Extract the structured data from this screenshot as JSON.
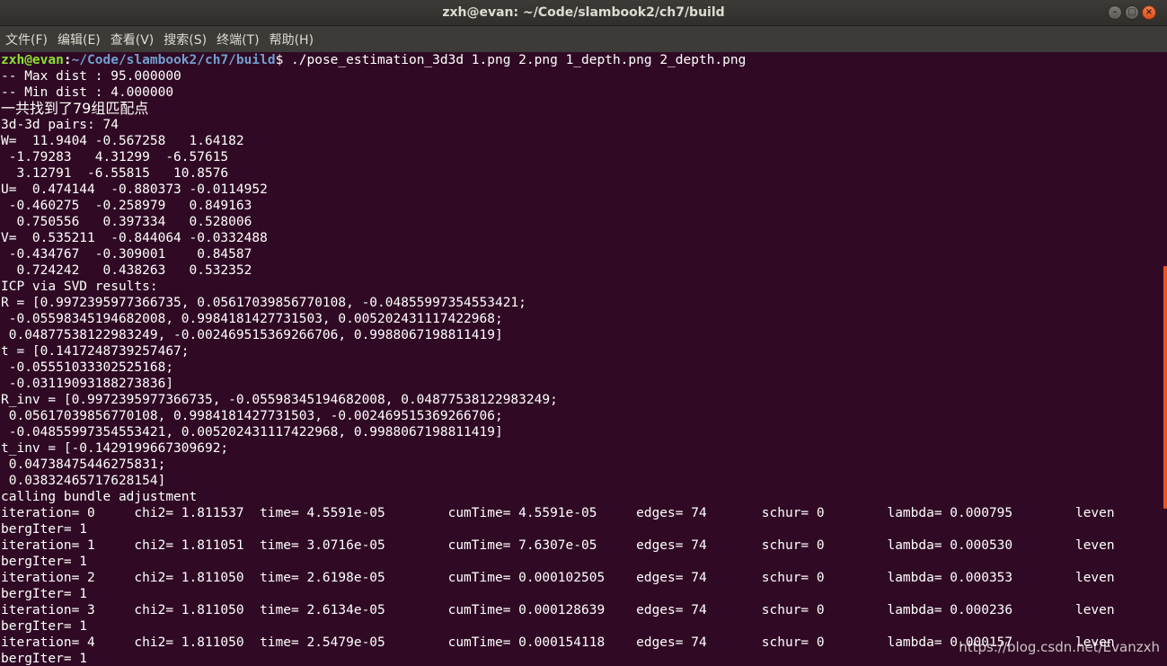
{
  "window": {
    "title": "zxh@evan: ~/Code/slambook2/ch7/build",
    "buttons": {
      "minimize": "–",
      "maximize": "□",
      "close": "×"
    }
  },
  "menu": [
    {
      "label": "文件(F)"
    },
    {
      "label": "编辑(E)"
    },
    {
      "label": "查看(V)"
    },
    {
      "label": "搜索(S)"
    },
    {
      "label": "终端(T)"
    },
    {
      "label": "帮助(H)"
    }
  ],
  "prompt": {
    "user": "zxh@evan",
    "colon": ":",
    "path": "~/Code/slambook2/ch7/build",
    "command": "$ ./pose_estimation_3d3d 1.png 2.png 1_depth.png 2_depth.png"
  },
  "output": [
    "-- Max dist : 95.000000",
    "-- Min dist : 4.000000",
    "一共找到了79组匹配点",
    "3d-3d pairs: 74",
    "W=  11.9404 -0.567258   1.64182",
    " -1.79283   4.31299  -6.57615",
    "  3.12791  -6.55815   10.8576",
    "U=  0.474144  -0.880373 -0.0114952",
    " -0.460275  -0.258979   0.849163",
    "  0.750556   0.397334   0.528006",
    "V=  0.535211  -0.844064 -0.0332488",
    " -0.434767  -0.309001    0.84587",
    "  0.724242   0.438263   0.532352",
    "ICP via SVD results:",
    "R = [0.9972395977366735, 0.05617039856770108, -0.04855997354553421;",
    " -0.05598345194682008, 0.9984181427731503, 0.005202431117422968;",
    " 0.04877538122983249, -0.002469515369266706, 0.9988067198811419]",
    "t = [0.1417248739257467;",
    " -0.05551033302525168;",
    " -0.03119093188273836]",
    "R_inv = [0.9972395977366735, -0.05598345194682008, 0.04877538122983249;",
    " 0.05617039856770108, 0.9984181427731503, -0.002469515369266706;",
    " -0.04855997354553421, 0.005202431117422968, 0.9988067198811419]",
    "t_inv = [-0.1429199667309692;",
    " 0.04738475446275831;",
    " 0.03832465717628154]",
    "calling bundle adjustment",
    "iteration= 0     chi2= 1.811537  time= 4.5591e-05        cumTime= 4.5591e-05     edges= 74       schur= 0        lambda= 0.000795        leven",
    "bergIter= 1",
    "iteration= 1     chi2= 1.811051  time= 3.0716e-05        cumTime= 7.6307e-05     edges= 74       schur= 0        lambda= 0.000530        leven",
    "bergIter= 1",
    "iteration= 2     chi2= 1.811050  time= 2.6198e-05        cumTime= 0.000102505    edges= 74       schur= 0        lambda= 0.000353        leven",
    "bergIter= 1",
    "iteration= 3     chi2= 1.811050  time= 2.6134e-05        cumTime= 0.000128639    edges= 74       schur= 0        lambda= 0.000236        leven",
    "bergIter= 1",
    "iteration= 4     chi2= 1.811050  time= 2.5479e-05        cumTime= 0.000154118    edges= 74       schur= 0        lambda= 0.000157        leven",
    "bergIter= 1"
  ],
  "watermark": "https://blog.csdn.net/Evanzxh",
  "colors": {
    "background": "#300a24",
    "prompt_user": "#8ae234",
    "prompt_path": "#729fcf",
    "scroll_thumb": "#e95420"
  }
}
